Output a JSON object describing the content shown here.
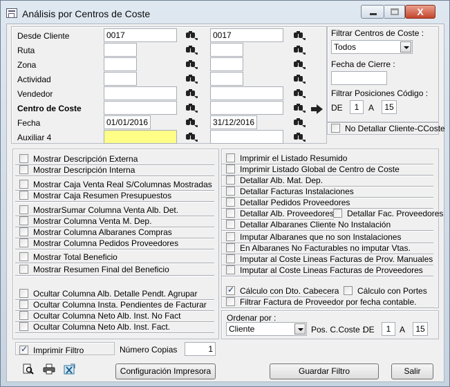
{
  "window": {
    "title": "Análisis por Centros de Coste",
    "close_glyph": "X"
  },
  "filters": {
    "rows": [
      {
        "label": "Desde Cliente",
        "from": "0017",
        "to": "0017",
        "bold": false
      },
      {
        "label": "Ruta",
        "from": "",
        "to": "",
        "bold": false
      },
      {
        "label": "Zona",
        "from": "",
        "to": "",
        "bold": false
      },
      {
        "label": "Actividad",
        "from": "",
        "to": "",
        "bold": false
      },
      {
        "label": "Vendedor",
        "from": "",
        "to": "",
        "bold": false
      },
      {
        "label": "Centro de Coste",
        "from": "",
        "to": "",
        "bold": true
      },
      {
        "label": "Fecha",
        "from": "01/01/2016",
        "to": "31/12/2016",
        "bold": false
      },
      {
        "label": "Auxiliar 4",
        "from": "",
        "to": "",
        "bold": false
      }
    ]
  },
  "right_panel": {
    "filtrar_centros_label": "Filtrar Centros de Coste :",
    "filtrar_centros_value": "Todos",
    "fecha_cierre_label": "Fecha de Cierre :",
    "fecha_cierre_value": "",
    "filtrar_pos_label": "Filtrar Posiciones Código :",
    "de_label": "DE",
    "de_value": "1",
    "a_label": "A",
    "a_value": "15",
    "no_detallar_label": "No Detallar Cliente-CCoste"
  },
  "left_options": [
    {
      "label": "Mostrar Descripción Externa",
      "checked": false
    },
    {
      "label": "Mostrar Descripción Interna",
      "checked": false
    },
    {
      "label": "Mostrar Caja Venta Real S/Columnas Mostradas",
      "checked": false
    },
    {
      "label": "Mostrar Caja Resumen Presupuestos",
      "checked": false
    },
    {
      "label": "MostrarSumar Columna Venta Alb. Det.",
      "checked": false
    },
    {
      "label": "Mostrar Columna Venta M. Dep.",
      "checked": false
    },
    {
      "label": "Mostrar Columna Albaranes Compras",
      "checked": false
    },
    {
      "label": "Mostrar Columna Pedidos Proveedores",
      "checked": false
    },
    {
      "label": "Mostrar Total Beneficio",
      "checked": false
    },
    {
      "label": "Mostrar Resumen Final del Beneficio",
      "checked": false
    },
    {
      "label": "Ocultar Columna Alb. Detalle Pendt. Agrupar",
      "checked": false
    },
    {
      "label": "Ocultar Columna Insta. Pendientes de Facturar",
      "checked": false
    },
    {
      "label": "Ocultar Columna Neto Alb. Inst. No Fact",
      "checked": false
    },
    {
      "label": "Ocultar Columna Neto Alb. Inst. Fact.",
      "checked": false
    }
  ],
  "right_options": [
    {
      "label": "Imprimir el Listado Resumido",
      "checked": false
    },
    {
      "label": "Imprimir Listado Global de Centro de Coste",
      "checked": false
    },
    {
      "label": "Detallar Alb. Mat. Dep.",
      "checked": false
    },
    {
      "label": "Detallar Facturas Instalaciones",
      "checked": false
    },
    {
      "label": "Detallar Pedidos Proveedores",
      "checked": false
    },
    {
      "label": "Detallar Alb. Proveedores",
      "checked": false
    },
    {
      "label": "Detallar Fac. Proveedores",
      "checked": false
    },
    {
      "label": "Detallar Albaranes Cliente No Instalación",
      "checked": false
    },
    {
      "label": "Imputar Albaranes que no son Instalaciones",
      "checked": false
    },
    {
      "label": "En Albaranes No Facturables no imputar Vtas.",
      "checked": false
    },
    {
      "label": "Imputar al Coste Lineas Facturas de Prov. Manuales",
      "checked": false
    },
    {
      "label": "Imputar al Coste Lineas Facturas de Proveedores",
      "checked": false
    },
    {
      "label": "Cálculo con Dto. Cabecera",
      "checked": true
    },
    {
      "label": "Cálculo con Portes",
      "checked": false
    },
    {
      "label": "Filtrar Factura de Proveedor por fecha contable.",
      "checked": false
    }
  ],
  "order": {
    "label": "Ordenar por :",
    "value": "Cliente",
    "pos_label": "Pos. C.Coste :",
    "de_label": "DE",
    "de_value": "1",
    "a_label": "A",
    "a_value": "15"
  },
  "bottom": {
    "imprimir_filtro_label": "Imprimir Filtro",
    "imprimir_filtro_checked": true,
    "copias_label": "Número Copias",
    "copias_value": "1",
    "config_button": "Configuración Impresora",
    "guardar_button": "Guardar Filtro",
    "salir_button": "Salir"
  }
}
